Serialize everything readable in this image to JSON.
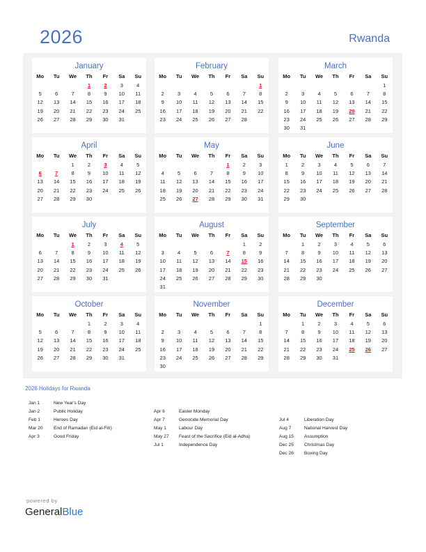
{
  "header": {
    "year": "2026",
    "country": "Rwanda"
  },
  "weekday_labels": [
    "Mo",
    "Tu",
    "We",
    "Th",
    "Fr",
    "Sa",
    "Su"
  ],
  "months": [
    {
      "name": "January",
      "weeks": [
        [
          "",
          "",
          "",
          "1",
          "2",
          "3",
          "4"
        ],
        [
          "5",
          "6",
          "7",
          "8",
          "9",
          "10",
          "11"
        ],
        [
          "12",
          "13",
          "14",
          "15",
          "16",
          "17",
          "18"
        ],
        [
          "19",
          "20",
          "21",
          "22",
          "23",
          "24",
          "25"
        ],
        [
          "26",
          "27",
          "28",
          "29",
          "30",
          "31",
          ""
        ]
      ],
      "holidays": [
        "1",
        "2"
      ]
    },
    {
      "name": "February",
      "weeks": [
        [
          "",
          "",
          "",
          "",
          "",
          "",
          "1"
        ],
        [
          "2",
          "3",
          "4",
          "5",
          "6",
          "7",
          "8"
        ],
        [
          "9",
          "10",
          "11",
          "12",
          "13",
          "14",
          "15"
        ],
        [
          "16",
          "17",
          "18",
          "19",
          "20",
          "21",
          "22"
        ],
        [
          "23",
          "24",
          "25",
          "26",
          "27",
          "28",
          ""
        ]
      ],
      "holidays": [
        "1"
      ]
    },
    {
      "name": "March",
      "weeks": [
        [
          "",
          "",
          "",
          "",
          "",
          "",
          "1"
        ],
        [
          "2",
          "3",
          "4",
          "5",
          "6",
          "7",
          "8"
        ],
        [
          "9",
          "10",
          "11",
          "12",
          "13",
          "14",
          "15"
        ],
        [
          "16",
          "17",
          "18",
          "19",
          "20",
          "21",
          "22"
        ],
        [
          "23",
          "24",
          "25",
          "26",
          "27",
          "28",
          "29"
        ],
        [
          "30",
          "31",
          "",
          "",
          "",
          "",
          ""
        ]
      ],
      "holidays": [
        "20"
      ]
    },
    {
      "name": "April",
      "weeks": [
        [
          "",
          "",
          "1",
          "2",
          "3",
          "4",
          "5"
        ],
        [
          "6",
          "7",
          "8",
          "9",
          "10",
          "11",
          "12"
        ],
        [
          "13",
          "14",
          "15",
          "16",
          "17",
          "18",
          "19"
        ],
        [
          "20",
          "21",
          "22",
          "23",
          "24",
          "25",
          "26"
        ],
        [
          "27",
          "28",
          "29",
          "30",
          "",
          "",
          ""
        ]
      ],
      "holidays": [
        "3",
        "6",
        "7"
      ]
    },
    {
      "name": "May",
      "weeks": [
        [
          "",
          "",
          "",
          "",
          "1",
          "2",
          "3"
        ],
        [
          "4",
          "5",
          "6",
          "7",
          "8",
          "9",
          "10"
        ],
        [
          "11",
          "12",
          "13",
          "14",
          "15",
          "16",
          "17"
        ],
        [
          "18",
          "19",
          "20",
          "21",
          "22",
          "23",
          "24"
        ],
        [
          "25",
          "26",
          "27",
          "28",
          "29",
          "30",
          "31"
        ]
      ],
      "holidays": [
        "1",
        "27"
      ]
    },
    {
      "name": "June",
      "weeks": [
        [
          "1",
          "2",
          "3",
          "4",
          "5",
          "6",
          "7"
        ],
        [
          "8",
          "9",
          "10",
          "11",
          "12",
          "13",
          "14"
        ],
        [
          "15",
          "16",
          "17",
          "18",
          "19",
          "20",
          "21"
        ],
        [
          "22",
          "23",
          "24",
          "25",
          "26",
          "27",
          "28"
        ],
        [
          "29",
          "30",
          "",
          "",
          "",
          "",
          ""
        ]
      ],
      "holidays": []
    },
    {
      "name": "July",
      "weeks": [
        [
          "",
          "",
          "1",
          "2",
          "3",
          "4",
          "5"
        ],
        [
          "6",
          "7",
          "8",
          "9",
          "10",
          "11",
          "12"
        ],
        [
          "13",
          "14",
          "15",
          "16",
          "17",
          "18",
          "19"
        ],
        [
          "20",
          "21",
          "22",
          "23",
          "24",
          "25",
          "26"
        ],
        [
          "27",
          "28",
          "29",
          "30",
          "31",
          "",
          ""
        ]
      ],
      "holidays": [
        "1",
        "4"
      ]
    },
    {
      "name": "August",
      "weeks": [
        [
          "",
          "",
          "",
          "",
          "",
          "1",
          "2"
        ],
        [
          "3",
          "4",
          "5",
          "6",
          "7",
          "8",
          "9"
        ],
        [
          "10",
          "11",
          "12",
          "13",
          "14",
          "15",
          "16"
        ],
        [
          "17",
          "18",
          "19",
          "20",
          "21",
          "22",
          "23"
        ],
        [
          "24",
          "25",
          "26",
          "27",
          "28",
          "29",
          "30"
        ],
        [
          "31",
          "",
          "",
          "",
          "",
          "",
          ""
        ]
      ],
      "holidays": [
        "7",
        "15"
      ]
    },
    {
      "name": "September",
      "weeks": [
        [
          "",
          "1",
          "2",
          "3",
          "4",
          "5",
          "6"
        ],
        [
          "7",
          "8",
          "9",
          "10",
          "11",
          "12",
          "13"
        ],
        [
          "14",
          "15",
          "16",
          "17",
          "18",
          "19",
          "20"
        ],
        [
          "21",
          "22",
          "23",
          "24",
          "25",
          "26",
          "27"
        ],
        [
          "28",
          "29",
          "30",
          "",
          "",
          "",
          ""
        ]
      ],
      "holidays": []
    },
    {
      "name": "October",
      "weeks": [
        [
          "",
          "",
          "",
          "1",
          "2",
          "3",
          "4"
        ],
        [
          "5",
          "6",
          "7",
          "8",
          "9",
          "10",
          "11"
        ],
        [
          "12",
          "13",
          "14",
          "15",
          "16",
          "17",
          "18"
        ],
        [
          "19",
          "20",
          "21",
          "22",
          "23",
          "24",
          "25"
        ],
        [
          "26",
          "27",
          "28",
          "29",
          "30",
          "31",
          ""
        ]
      ],
      "holidays": []
    },
    {
      "name": "November",
      "weeks": [
        [
          "",
          "",
          "",
          "",
          "",
          "",
          "1"
        ],
        [
          "2",
          "3",
          "4",
          "5",
          "6",
          "7",
          "8"
        ],
        [
          "9",
          "10",
          "11",
          "12",
          "13",
          "14",
          "15"
        ],
        [
          "16",
          "17",
          "18",
          "19",
          "20",
          "21",
          "22"
        ],
        [
          "23",
          "24",
          "25",
          "26",
          "27",
          "28",
          "29"
        ],
        [
          "30",
          "",
          "",
          "",
          "",
          "",
          ""
        ]
      ],
      "holidays": []
    },
    {
      "name": "December",
      "weeks": [
        [
          "",
          "1",
          "2",
          "3",
          "4",
          "5",
          "6"
        ],
        [
          "7",
          "8",
          "9",
          "10",
          "11",
          "12",
          "13"
        ],
        [
          "14",
          "15",
          "16",
          "17",
          "18",
          "19",
          "20"
        ],
        [
          "21",
          "22",
          "23",
          "24",
          "25",
          "26",
          "27"
        ],
        [
          "28",
          "29",
          "30",
          "31",
          "",
          "",
          ""
        ]
      ],
      "holidays": [
        "25",
        "26"
      ]
    }
  ],
  "holidays_section": {
    "title": "2026 Holidays for Rwanda",
    "columns": [
      [
        {
          "date": "Jan 1",
          "name": "New Year's Day"
        },
        {
          "date": "Jan 2",
          "name": "Public Holiday"
        },
        {
          "date": "Feb 1",
          "name": "Heroes Day"
        },
        {
          "date": "Mar 20",
          "name": "End of Ramadan (Eid al-Fitr)"
        },
        {
          "date": "Apr 3",
          "name": "Good Friday"
        }
      ],
      [
        {
          "date": "Apr 6",
          "name": "Easter Monday"
        },
        {
          "date": "Apr 7",
          "name": "Genocide Memorial Day"
        },
        {
          "date": "May 1",
          "name": "Labour Day"
        },
        {
          "date": "May 27",
          "name": "Feast of the Sacrifice (Eid al-Adha)"
        },
        {
          "date": "Jul 1",
          "name": "Independence Day"
        }
      ],
      [
        {
          "date": "Jul 4",
          "name": "Liberation Day"
        },
        {
          "date": "Aug 7",
          "name": "National Harvest Day"
        },
        {
          "date": "Aug 15",
          "name": "Assumption"
        },
        {
          "date": "Dec 25",
          "name": "Christmas Day"
        },
        {
          "date": "Dec 26",
          "name": "Boxing Day"
        }
      ]
    ]
  },
  "footer": {
    "powered_by": "powered by",
    "brand_part1": "General",
    "brand_part2": "Blue"
  },
  "colors": {
    "accent": "#4472c4",
    "holiday": "#e0141c",
    "panel_bg": "#f2f2f2"
  }
}
